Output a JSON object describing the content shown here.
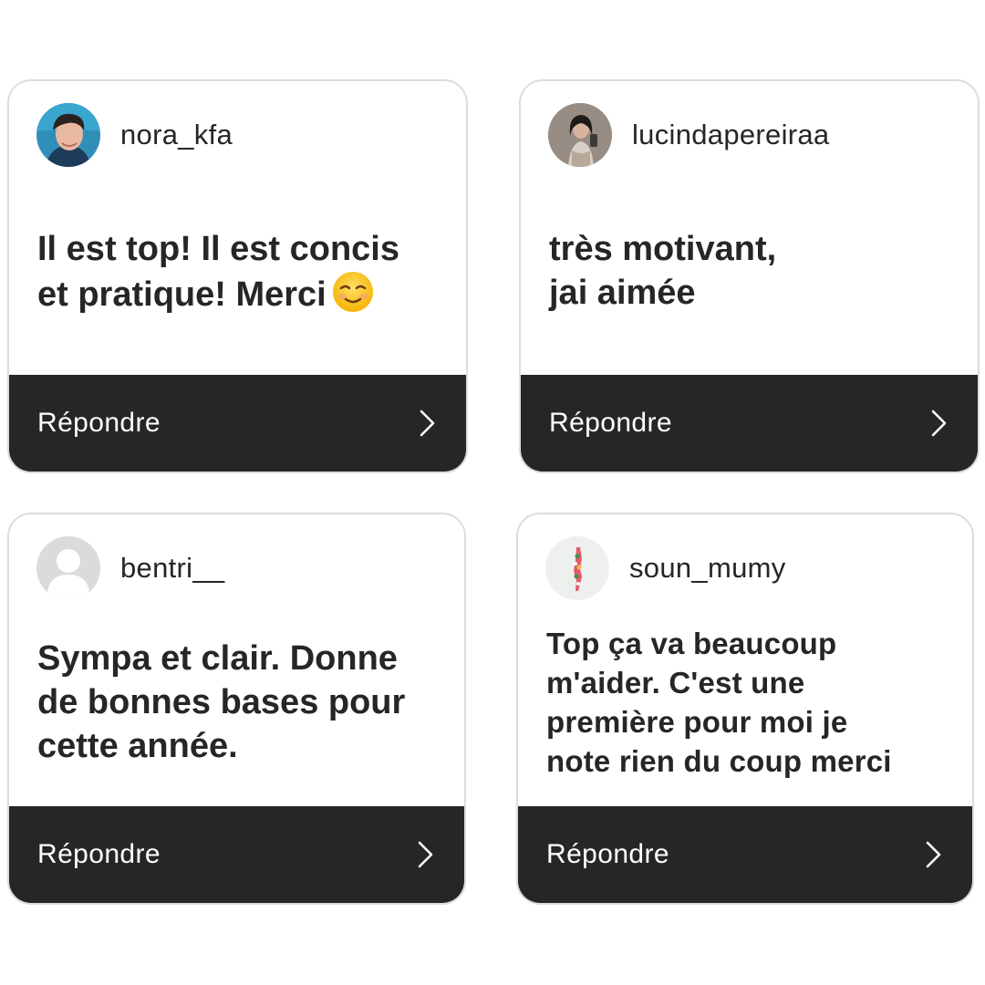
{
  "cards": [
    {
      "username": "nora_kfa",
      "message": "Il est top! Il est concis\net pratique! Merci",
      "emoji": "smiling-face-icon",
      "avatar_icon": "profile-photo",
      "reply_label": "Répondre"
    },
    {
      "username": "lucindapereiraa",
      "message": "très motivant,\njai aimée",
      "avatar_icon": "profile-photo",
      "reply_label": "Répondre"
    },
    {
      "username": "bentri__",
      "message": "Sympa et clair. Donne\nde bonnes bases pour\ncette année.",
      "avatar_icon": "default-avatar",
      "reply_label": "Répondre"
    },
    {
      "username": "soun_mumy",
      "message": "Top ça va beaucoup\nm'aider. C'est une\npremière pour moi je\nnote rien du coup merci",
      "avatar_icon": "profile-photo",
      "reply_label": "Répondre"
    }
  ],
  "colors": {
    "bar_background": "#262626",
    "text": "#262626",
    "card_border": "#dcdcdc"
  }
}
